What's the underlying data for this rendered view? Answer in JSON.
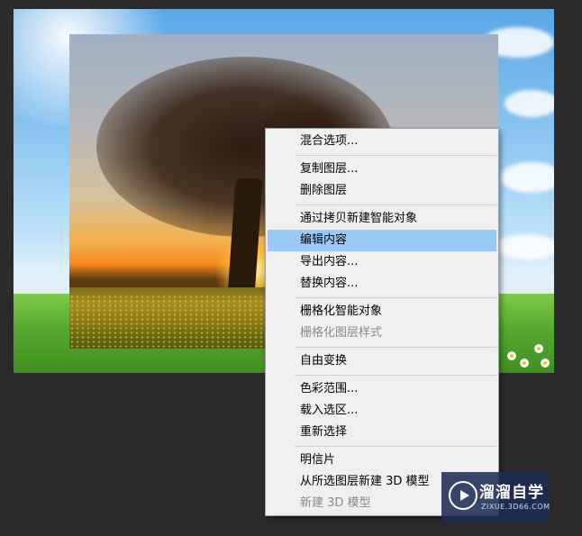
{
  "context_menu": {
    "items": [
      {
        "label": "混合选项...",
        "enabled": true,
        "highlighted": false
      },
      {
        "separator": true
      },
      {
        "label": "复制图层...",
        "enabled": true,
        "highlighted": false
      },
      {
        "label": "删除图层",
        "enabled": true,
        "highlighted": false
      },
      {
        "separator": true
      },
      {
        "label": "通过拷贝新建智能对象",
        "enabled": true,
        "highlighted": false
      },
      {
        "label": "编辑内容",
        "enabled": true,
        "highlighted": true
      },
      {
        "label": "导出内容...",
        "enabled": true,
        "highlighted": false
      },
      {
        "label": "替换内容...",
        "enabled": true,
        "highlighted": false
      },
      {
        "separator": true
      },
      {
        "label": "栅格化智能对象",
        "enabled": true,
        "highlighted": false
      },
      {
        "label": "栅格化图层样式",
        "enabled": false,
        "highlighted": false
      },
      {
        "separator": true
      },
      {
        "label": "自由变换",
        "enabled": true,
        "highlighted": false
      },
      {
        "separator": true
      },
      {
        "label": "色彩范围...",
        "enabled": true,
        "highlighted": false
      },
      {
        "label": "载入选区...",
        "enabled": true,
        "highlighted": false
      },
      {
        "label": "重新选择",
        "enabled": true,
        "highlighted": false
      },
      {
        "separator": true
      },
      {
        "label": "明信片",
        "enabled": true,
        "highlighted": false
      },
      {
        "label": "从所选图层新建 3D 模型",
        "enabled": true,
        "highlighted": false
      },
      {
        "label": "新建 3D 模型",
        "enabled": false,
        "highlighted": false
      }
    ]
  },
  "watermark": {
    "title": "溜溜自学",
    "subtitle": "ZIXUE.3D66.COM",
    "logo_icon": "play-circle-icon"
  },
  "colors": {
    "workspace_bg": "#2b2b2b",
    "menu_bg": "#f0f0f0",
    "menu_highlight": "#99c9f5",
    "menu_disabled_text": "#8a8a8a",
    "watermark_bg": "#1e2c56"
  }
}
